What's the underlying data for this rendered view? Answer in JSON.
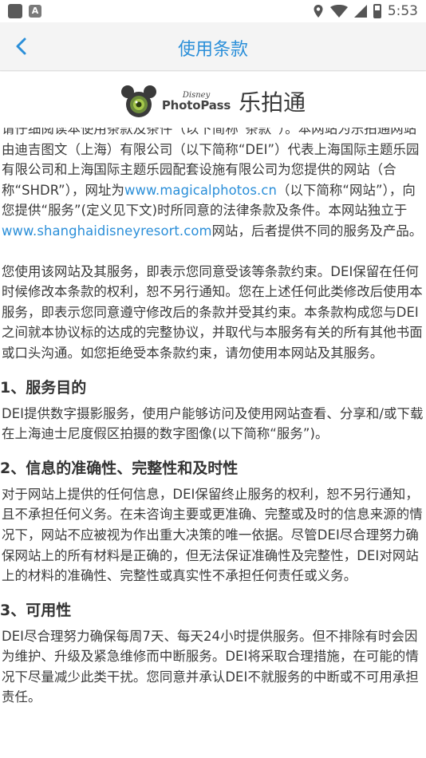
{
  "status_bar": {
    "time": "5:53",
    "icons": [
      "location-icon",
      "wifi-icon",
      "signal-icon",
      "battery-icon"
    ]
  },
  "nav": {
    "back_icon": "chevron-left-icon",
    "title": "使用条款"
  },
  "logo": {
    "disney": "Disney",
    "photopass": "PhotoPass",
    "cn_name": "乐拍通"
  },
  "content": {
    "partial_line": "请仔细阅读本使用条款及条件（以下简称“条款”）。本网站为乐拍通网站",
    "intro": {
      "part1": "由迪吉图文（上海）有限公司（以下简称“DEI”）代表上海国际主题乐园有限公司和上海国际主题乐园配套设施有限公司为您提供的网站（合称“SHDR”），网址为",
      "link1": "www.magicalphotos.cn",
      "part2": "（以下简称“网站”），向您提供“服务”(定义见下文)时所同意的法律条款及条件。本网站独立于",
      "link2": "www.shanghaidisneyresort.com",
      "part3": "网站，后者提供不同的服务及产品。"
    },
    "para2": "您使用该网站及其服务，即表示您同意受该等条款约束。DEI保留在任何时候修改本条款的权利，恕不另行通知。您在上述任何此类修改后使用本服务，即表示您同意遵守修改后的条款并受其约束。本条款构成您与DEI之间就本协议标的达成的完整协议，并取代与本服务有关的所有其他书面或口头沟通。如您拒绝受本条款约束，请勿使用本网站及其服务。",
    "sections": [
      {
        "heading": "1、服务目的",
        "text": "DEI提供数字摄影服务，使用户能够访问及使用网站查看、分享和/或下载在上海迪士尼度假区拍摄的数字图像(以下简称“服务”)。"
      },
      {
        "heading": "2、信息的准确性、完整性和及时性",
        "text": "对于网站上提供的任何信息，DEI保留终止服务的权利，恕不另行通知，且不承担任何义务。在未咨询主要或更准确、完整或及时的信息来源的情况下，网站不应被视为作出重大决策的唯一依据。尽管DEI尽合理努力确保网站上的所有材料是正确的，但无法保证准确性及完整性，DEI对网站上的材料的准确性、完整性或真实性不承担任何责任或义务。"
      },
      {
        "heading": "3、可用性",
        "text": "DEI尽合理努力确保每周7天、每天24小时提供服务。但不排除有时会因为维护、升级及紧急维修而中断服务。DEI将采取合理措施，在可能的情况下尽量减少此类干扰。您同意并承认DEI不就服务的中断或不可用承担责任。"
      }
    ]
  }
}
